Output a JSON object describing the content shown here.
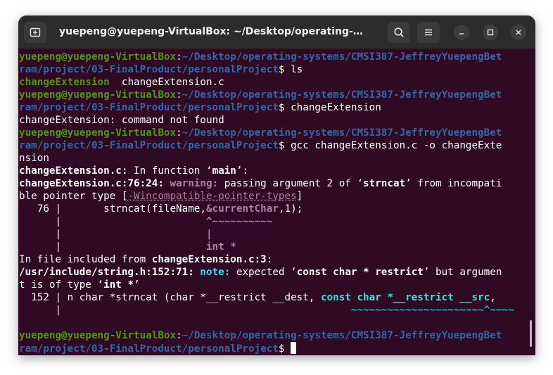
{
  "window": {
    "title": "yuepeng@yuepeng-VirtualBox: ~/Desktop/operating-syste…",
    "buttons": {
      "new_tab": "new-tab-icon",
      "search": "search-icon",
      "menu": "hamburger-menu-icon",
      "minimize": "minimize-icon",
      "maximize": "maximize-icon",
      "close": "close-icon"
    }
  },
  "colors": {
    "terminal_bg": "#300a24",
    "prompt_user": "#4e9a06",
    "prompt_path": "#3465a4",
    "warning": "#ad7fa8",
    "note": "#34e2e2"
  },
  "terminal": {
    "prompt_user": "yuepeng@yuepeng-VirtualBox",
    "colon": ":",
    "path_line1": "~/Desktop/operating-systems/CMSI387-JeffreyYuepengBet",
    "path_line2": "ram/project/03-FinalProduct/personalProject",
    "dollar": "$",
    "cmd1": " ls",
    "ls_dir": "changeExtension",
    "ls_file": "  changeExtension.c",
    "cmd2": " changeExtension",
    "not_found": "changeExtension: command not found",
    "cmd3": " gcc changeExtension.c -o changeExte",
    "cmd3_wrap": "nsion",
    "infunc_file": "changeExtension.c:",
    "infunc_text": " In function ",
    "q_open": "‘",
    "q_close": "’",
    "infunc_name": "main",
    "infunc_end": ":",
    "warn_loc": "changeExtension.c:76:24:",
    "warn_label": " warning:",
    "warn_text": " passing argument 2 of ",
    "warn_fn": "strncat",
    "warn_rest": " from incompati",
    "warn_wrap_a": "ble pointer type [",
    "warn_flag": "-Wincompatible-pointer-types",
    "warn_wrap_b": "]",
    "code_lineno": "   76 |       ",
    "code_a": "strncat(fileName,",
    "code_hl": "&currentChar",
    "code_b": ",1);",
    "gutter_blank": "      |",
    "caret_pad": "                        ",
    "caret": "^~~~~~~~~~~",
    "bar_pad": "                        ",
    "bar": "|",
    "type_pad": "                        ",
    "type": "int *",
    "included": "In file included from ",
    "included_file": "changeExtension.c:3",
    "included_end": ":",
    "note_loc": "/usr/include/string.h:152:71:",
    "note_label": " note:",
    "note_text": " expected ",
    "note_type": "const char * restrict",
    "note_rest": " but argumen",
    "note_wrap": "t is of type ",
    "note_wrap_type": "int *",
    "code2_lineno": "  152 | ",
    "code2_a": "n char *strncat (char *__restrict __dest, ",
    "code2_hl": "const char *__restrict __src",
    "code2_b": ",",
    "underline_pad": "                                                ",
    "underline": "~~~~~~~~~~~~~~~~~~~~~~^~~~~"
  }
}
